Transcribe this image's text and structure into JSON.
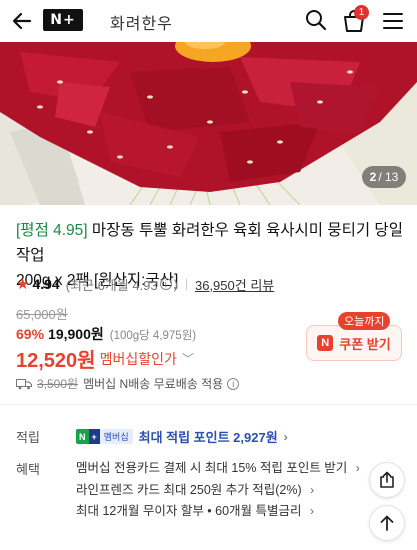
{
  "header": {
    "brand_badge": "N+",
    "brand_name": "화려한우",
    "cart_count": "1"
  },
  "gallery": {
    "current": "2",
    "total": "/ 13"
  },
  "product": {
    "title_tag": "[평점 4.95]",
    "title_line1": " 마장동 투뿔 화려한우 육회 육사시미 뭉티기 당일작업",
    "title_line2": "200g x 2팩 [원산지:국산]"
  },
  "rating": {
    "score": "4.94",
    "recent": "(최근 6개월 4.93",
    "recent_close": ")",
    "reviews": "36,950건 리뷰",
    "star_color": "#e8422f"
  },
  "price": {
    "original": "65,000원",
    "discount_pct": "69%",
    "discount_price": "19,900원",
    "unit_price": "(100g당 4,975원)",
    "member_price": "12,520원",
    "member_label": "멤버십할인가"
  },
  "coupon": {
    "tag": "오늘까지",
    "label": "쿠폰 받기",
    "icon": "N"
  },
  "shipping": {
    "original_fee": "3,500원",
    "text": "멤버십 N배송 무료배송 적용"
  },
  "points": {
    "label": "적립",
    "badge_n": "N",
    "badge_plus": "+",
    "badge_text": "멤버십",
    "text": "최대 적립 포인트 2,927원"
  },
  "benefits": {
    "label": "혜택",
    "items": [
      "멤버십 전용카드 결제 시 최대 15% 적립 포인트 받기",
      "라인프렌즈 카드 최대 250원 추가 적립(2%)",
      "최대 12개월 무이자 할부 • 60개월 특별금리"
    ]
  },
  "colors": {
    "accent": "#e8422f",
    "points_blue": "#2a4fb0",
    "title_tag": "#1a8a4a"
  }
}
